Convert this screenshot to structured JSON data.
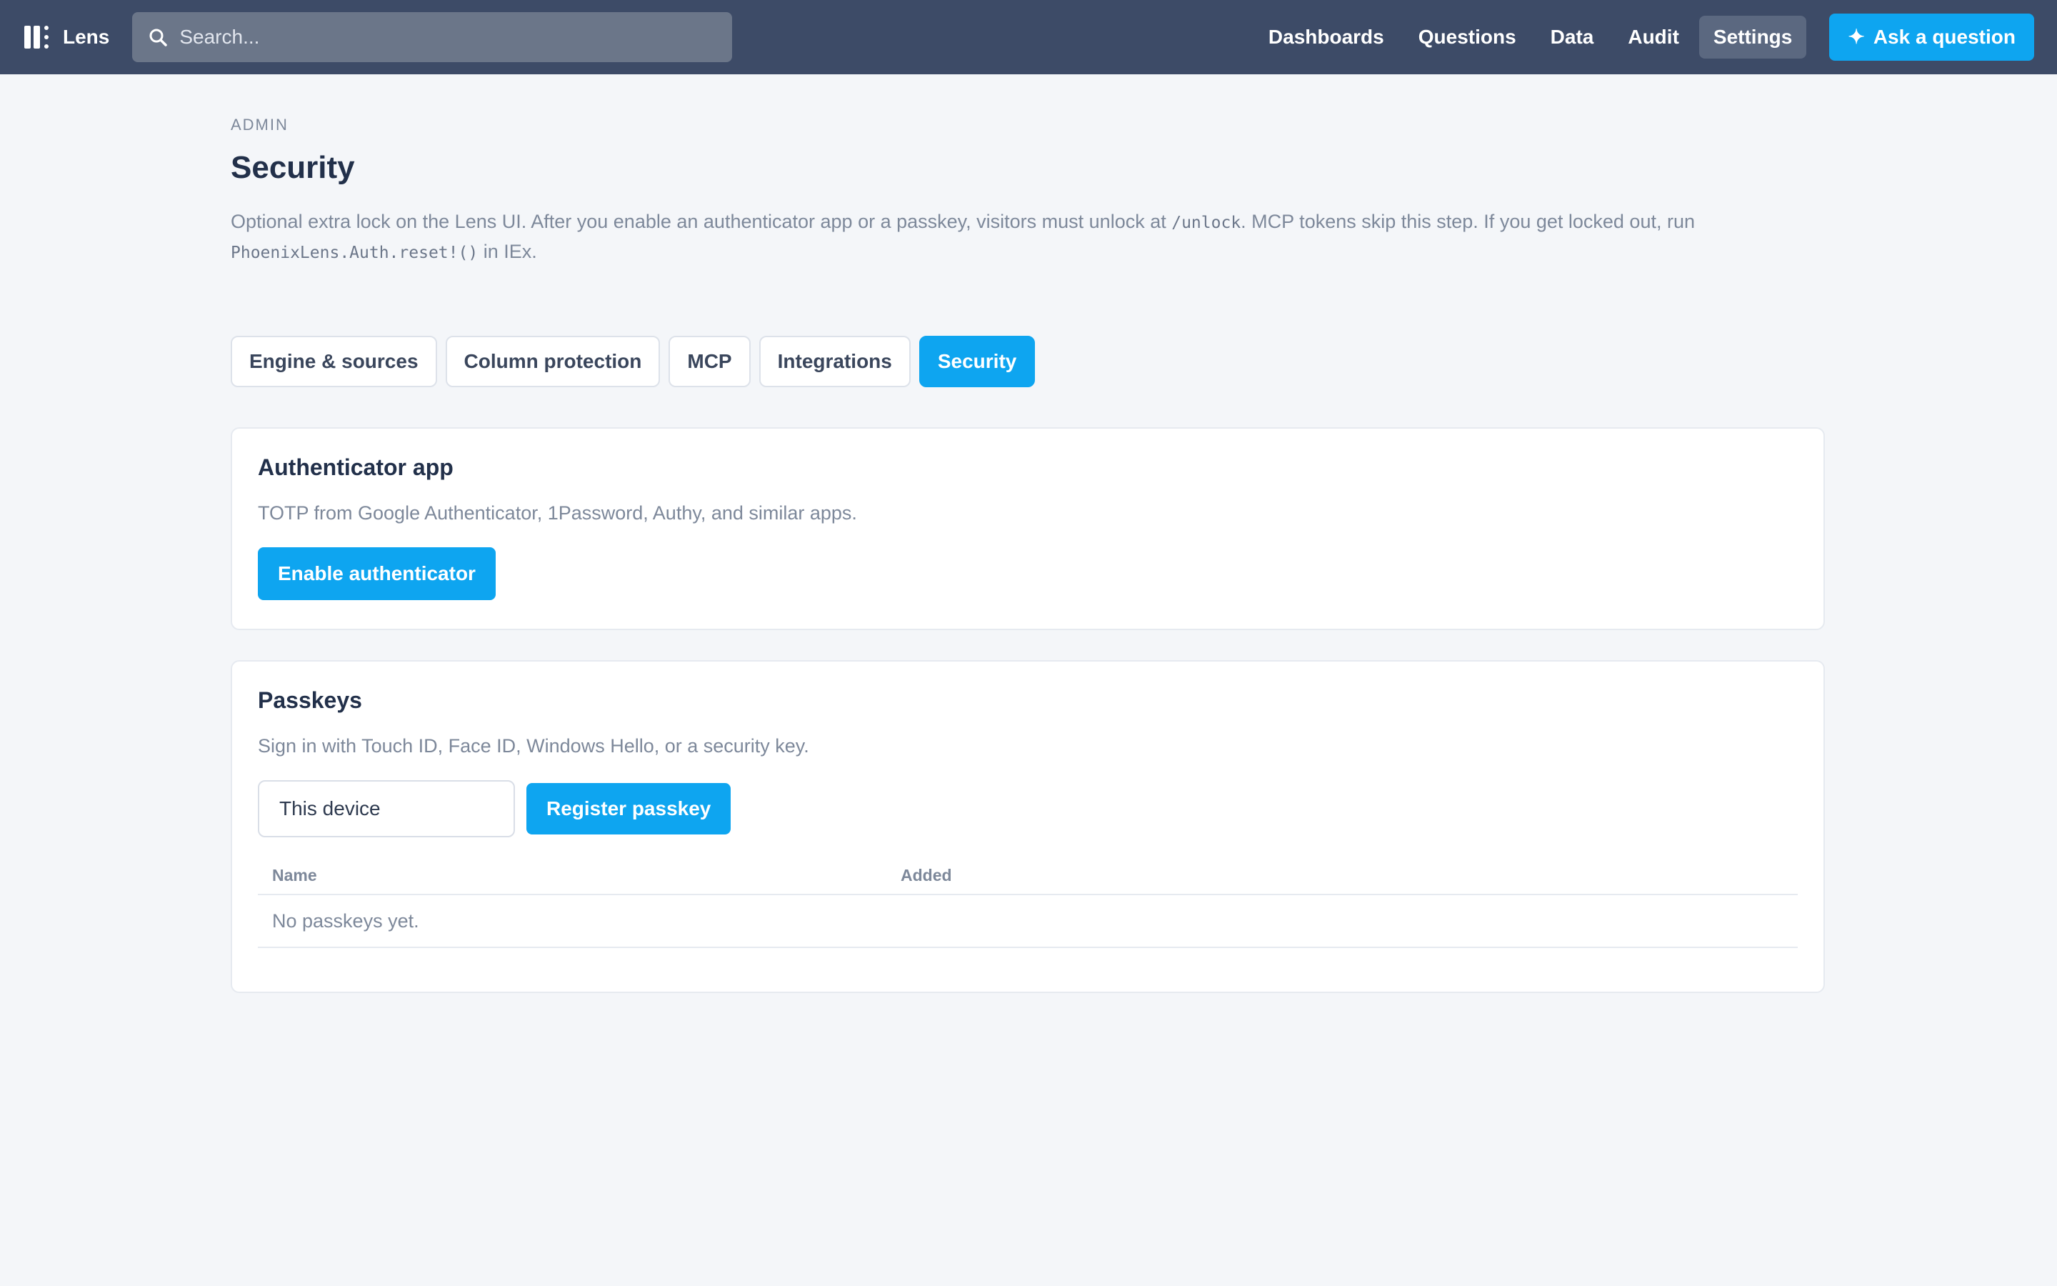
{
  "app": {
    "name": "Lens",
    "logo_icon": "lens-logo-icon",
    "accent_color": "#0ea5f0",
    "header_color": "#3d4b67"
  },
  "search": {
    "placeholder": "Search...",
    "icon": "search-icon"
  },
  "nav": {
    "items": [
      {
        "label": "Dashboards",
        "active": false
      },
      {
        "label": "Questions",
        "active": false
      },
      {
        "label": "Data",
        "active": false
      },
      {
        "label": "Audit",
        "active": false
      },
      {
        "label": "Settings",
        "active": true
      }
    ],
    "ask_button": {
      "label": "Ask a question",
      "icon": "sparkle-icon"
    }
  },
  "page": {
    "eyebrow": "ADMIN",
    "title": "Security",
    "description": {
      "part1": "Optional extra lock on the Lens UI. After you enable an authenticator app or a passkey, visitors must unlock at ",
      "code1": "/unlock",
      "part2": ". MCP tokens skip this step. If you get locked out, run ",
      "code2": "PhoenixLens.Auth.reset!()",
      "part3": " in IEx."
    }
  },
  "tabs": [
    {
      "label": "Engine & sources",
      "active": false
    },
    {
      "label": "Column protection",
      "active": false
    },
    {
      "label": "MCP",
      "active": false
    },
    {
      "label": "Integrations",
      "active": false
    },
    {
      "label": "Security",
      "active": true
    }
  ],
  "authenticator": {
    "title": "Authenticator app",
    "description": "TOTP from Google Authenticator, 1Password, Authy, and similar apps.",
    "button": "Enable authenticator"
  },
  "passkeys": {
    "title": "Passkeys",
    "description": "Sign in with Touch ID, Face ID, Windows Hello, or a security key.",
    "device_name_value": "This device",
    "register_button": "Register passkey",
    "table": {
      "columns": [
        "Name",
        "Added"
      ],
      "empty_message": "No passkeys yet."
    }
  }
}
